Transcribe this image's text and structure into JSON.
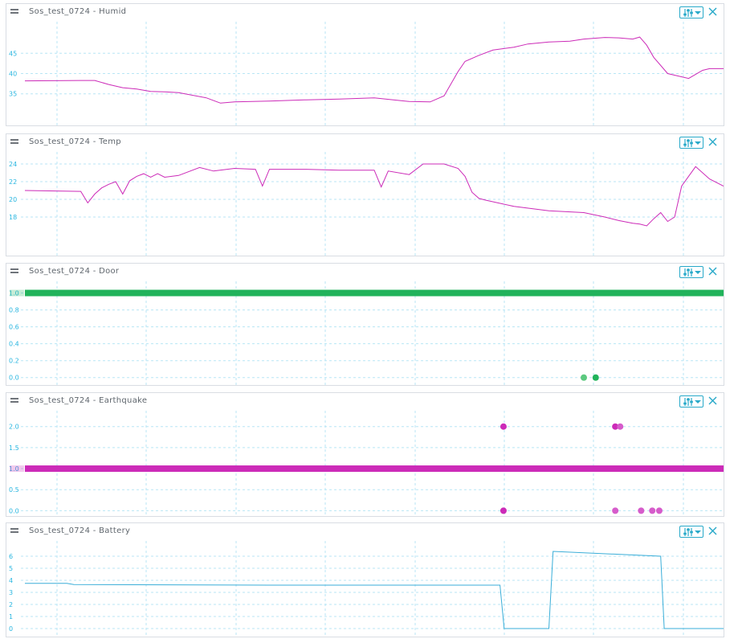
{
  "colors": {
    "accent": "#28a9c9",
    "grid": "#b8e6f5",
    "axis_text": "#29b6e0",
    "magenta": "#cc2bb8",
    "green": "#21b35a",
    "blue": "#3aaed8"
  },
  "icons": {
    "drag": "drag-handle-icon",
    "settings": "sliders-dropdown-icon",
    "close": "close-icon"
  },
  "panels": [
    {
      "title": "Sos_test_0724 - Humid"
    },
    {
      "title": "Sos_test_0724 - Temp"
    },
    {
      "title": "Sos_test_0724 - Door"
    },
    {
      "title": "Sos_test_0724 - Earthquake"
    },
    {
      "title": "Sos_test_0724 - Battery"
    }
  ],
  "chart_data": [
    {
      "type": "line",
      "title": "Sos_test_0724 - Humid",
      "ylim": [
        28,
        52
      ],
      "yticks": [
        "35",
        "40",
        "45"
      ],
      "grid": true,
      "series": [
        {
          "color": "#cc2bb8",
          "x": [
            0,
            8,
            10,
            12,
            14,
            16,
            18,
            20,
            22,
            26,
            28,
            30,
            35,
            40,
            45,
            50,
            55,
            58,
            60,
            62,
            63,
            65,
            67,
            70,
            72,
            75,
            78,
            80,
            83,
            85,
            87,
            88,
            89,
            90,
            92,
            95,
            97,
            98,
            100
          ],
          "y": [
            38.2,
            38.3,
            38.3,
            37.3,
            36.5,
            36.2,
            35.6,
            35.5,
            35.3,
            34.0,
            32.7,
            33.0,
            33.2,
            33.5,
            33.7,
            34.0,
            33.1,
            33.0,
            34.5,
            40.5,
            43.0,
            44.5,
            45.8,
            46.5,
            47.3,
            47.8,
            48.0,
            48.5,
            48.9,
            48.8,
            48.5,
            49.0,
            47.0,
            44.0,
            40.0,
            38.8,
            40.8,
            41.2,
            41.2
          ]
        }
      ]
    },
    {
      "type": "line",
      "title": "Sos_test_0724 - Temp",
      "ylim": [
        14,
        25
      ],
      "yticks": [
        "18",
        "20",
        "22",
        "24"
      ],
      "grid": true,
      "series": [
        {
          "color": "#cc2bb8",
          "x": [
            0,
            8,
            9,
            10,
            11,
            12,
            13,
            14,
            15,
            16,
            17,
            18,
            19,
            20,
            22,
            25,
            27,
            30,
            33,
            34,
            35,
            40,
            45,
            50,
            51,
            52,
            55,
            57,
            60,
            62,
            63,
            64,
            65,
            66,
            70,
            75,
            80,
            83,
            85,
            87,
            88,
            89,
            90,
            91,
            92,
            93,
            94,
            96,
            98,
            100
          ],
          "y": [
            21.0,
            20.9,
            19.6,
            20.6,
            21.3,
            21.7,
            22.0,
            20.6,
            22.1,
            22.6,
            22.9,
            22.5,
            22.9,
            22.5,
            22.7,
            23.6,
            23.2,
            23.5,
            23.4,
            21.5,
            23.4,
            23.4,
            23.3,
            23.3,
            21.4,
            23.2,
            22.8,
            24.0,
            24.0,
            23.5,
            22.6,
            20.8,
            20.1,
            19.9,
            19.2,
            18.7,
            18.5,
            18.0,
            17.6,
            17.3,
            17.2,
            17.0,
            17.8,
            18.5,
            17.5,
            18.0,
            21.5,
            23.7,
            22.3,
            21.5
          ]
        }
      ]
    },
    {
      "type": "scatter",
      "title": "Sos_test_0724 - Door",
      "ylim": [
        -0.05,
        1.1
      ],
      "yticks": [
        "0.0",
        "0.2",
        "0.4",
        "0.6",
        "0.8",
        "1.0"
      ],
      "grid": true,
      "band_value": 1.0,
      "band_color": "#21b35a",
      "points": [
        {
          "x": 80,
          "y": 0,
          "color": "#5cc97f"
        },
        {
          "x": 81.7,
          "y": 0,
          "color": "#21b35a"
        }
      ]
    },
    {
      "type": "scatter",
      "title": "Sos_test_0724 - Earthquake",
      "ylim": [
        -0.05,
        2.3
      ],
      "yticks": [
        "0.0",
        "0.5",
        "1.0",
        "1.5",
        "2.0"
      ],
      "grid": true,
      "band_value": 1.0,
      "band_color": "#cc2bb8",
      "points": [
        {
          "x": 68.5,
          "y": 2,
          "color": "#cc2bb8"
        },
        {
          "x": 84.5,
          "y": 2,
          "color": "#cc2bb8"
        },
        {
          "x": 85.2,
          "y": 2,
          "color": "#d65ccb"
        },
        {
          "x": 68.5,
          "y": 0,
          "color": "#cc2bb8"
        },
        {
          "x": 84.5,
          "y": 0,
          "color": "#d65ccb"
        },
        {
          "x": 88.2,
          "y": 0,
          "color": "#d65ccb"
        },
        {
          "x": 89.8,
          "y": 0,
          "color": "#d65ccb"
        },
        {
          "x": 90.8,
          "y": 0,
          "color": "#d65ccb"
        }
      ]
    },
    {
      "type": "line",
      "title": "Sos_test_0724 - Battery",
      "ylim": [
        -0.4,
        7
      ],
      "yticks": [
        "0",
        "1",
        "2",
        "3",
        "4",
        "5",
        "6"
      ],
      "grid": true,
      "series": [
        {
          "color": "#3aaed8",
          "x": [
            0,
            6,
            7,
            35,
            40,
            68,
            68.6,
            75,
            75.6,
            91,
            91.5,
            100
          ],
          "y": [
            3.75,
            3.75,
            3.65,
            3.6,
            3.6,
            3.6,
            0.0,
            0.0,
            6.4,
            6.0,
            0.0,
            0.0
          ]
        }
      ]
    }
  ]
}
